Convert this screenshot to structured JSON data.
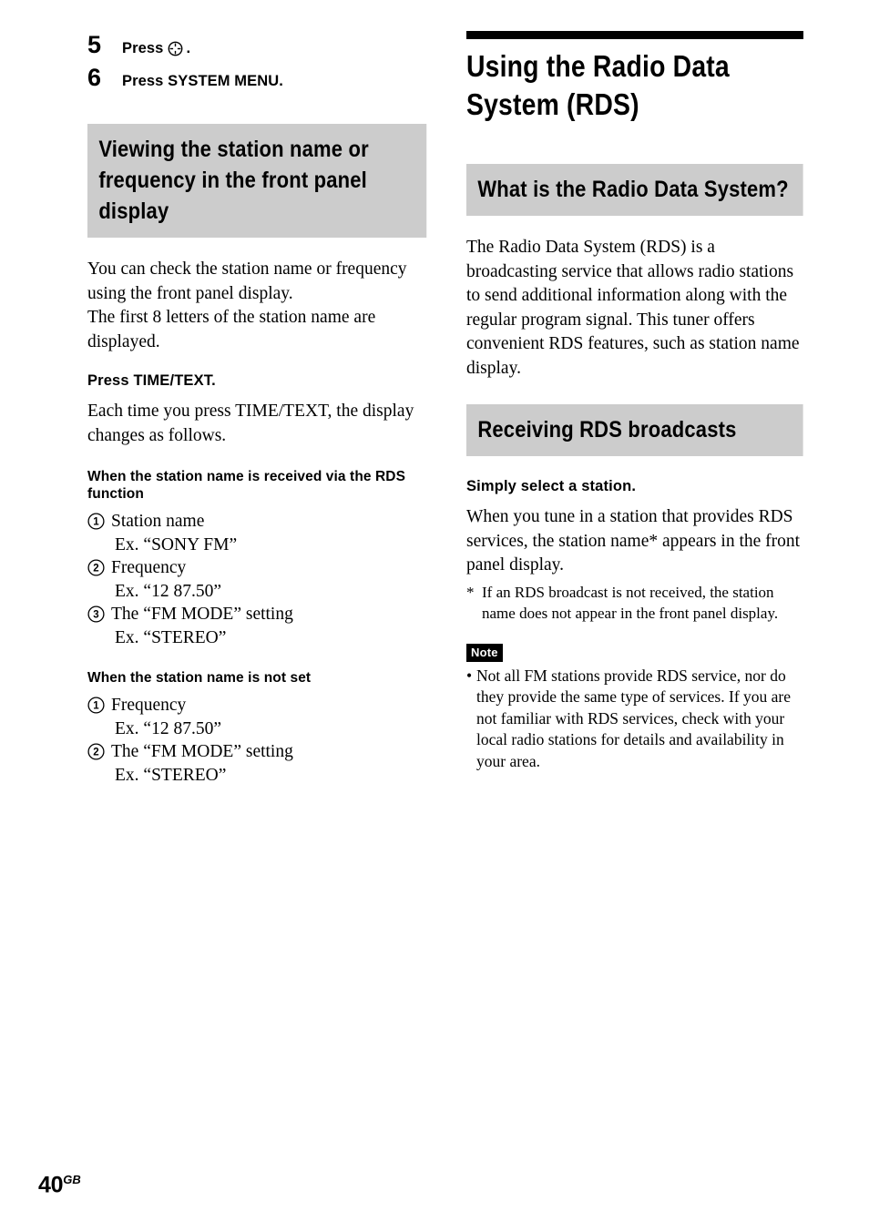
{
  "page": {
    "number": "40",
    "region_code": "GB"
  },
  "left_column": {
    "steps": [
      {
        "number": "5",
        "label": "Press",
        "icon": "enter-circle-icon",
        "suffix": "."
      },
      {
        "number": "6",
        "label": "Press SYSTEM MENU.",
        "icon": null,
        "suffix": ""
      }
    ],
    "section_heading": "Viewing the station name or frequency in the front panel display",
    "intro_paragraph": "You can check the station name or frequency using the front panel display.\nThe first 8 letters of the station name are displayed.",
    "press_instruction": "Press TIME/TEXT.",
    "press_description": "Each time you press TIME/TEXT, the display changes as follows.",
    "case_one": {
      "heading": "When the station name is received via the RDS function",
      "items": [
        {
          "marker": "1",
          "text": "Station name",
          "example": "Ex. “SONY FM”"
        },
        {
          "marker": "2",
          "text": "Frequency",
          "example": "Ex. “12  87.50”"
        },
        {
          "marker": "3",
          "text": "The “FM MODE” setting",
          "example": "Ex. “STEREO”"
        }
      ]
    },
    "case_two": {
      "heading": "When the station name is not set",
      "items": [
        {
          "marker": "1",
          "text": "Frequency",
          "example": "Ex. “12  87.50”"
        },
        {
          "marker": "2",
          "text": "The “FM MODE” setting",
          "example": "Ex. “STEREO”"
        }
      ]
    }
  },
  "right_column": {
    "chapter_title": "Using the Radio Data System (RDS)",
    "section_what_is": {
      "heading": "What is the Radio Data System?",
      "paragraph": "The Radio Data System (RDS) is a broadcasting service that allows radio stations to send additional information along with the regular program signal. This tuner offers convenient RDS features, such as station name display."
    },
    "section_receiving": {
      "heading": "Receiving RDS broadcasts",
      "lead_bold": "Simply select a station.",
      "paragraph": "When you tune in a station that provides RDS services, the station name* appears in the front panel display.",
      "footnote_mark": "*",
      "footnote_text": "If an RDS broadcast is not received, the station name does not appear in the front panel display.",
      "note_badge": "Note",
      "note_bullet": "•",
      "note_text": "Not all FM stations provide RDS service, nor do they provide the same type of services. If you are not familiar with RDS services, check with your local radio stations for details and availability in your area."
    }
  },
  "colors": {
    "heading_band": "#cccccc",
    "rule": "#000000",
    "text": "#000000",
    "background": "#ffffff"
  }
}
